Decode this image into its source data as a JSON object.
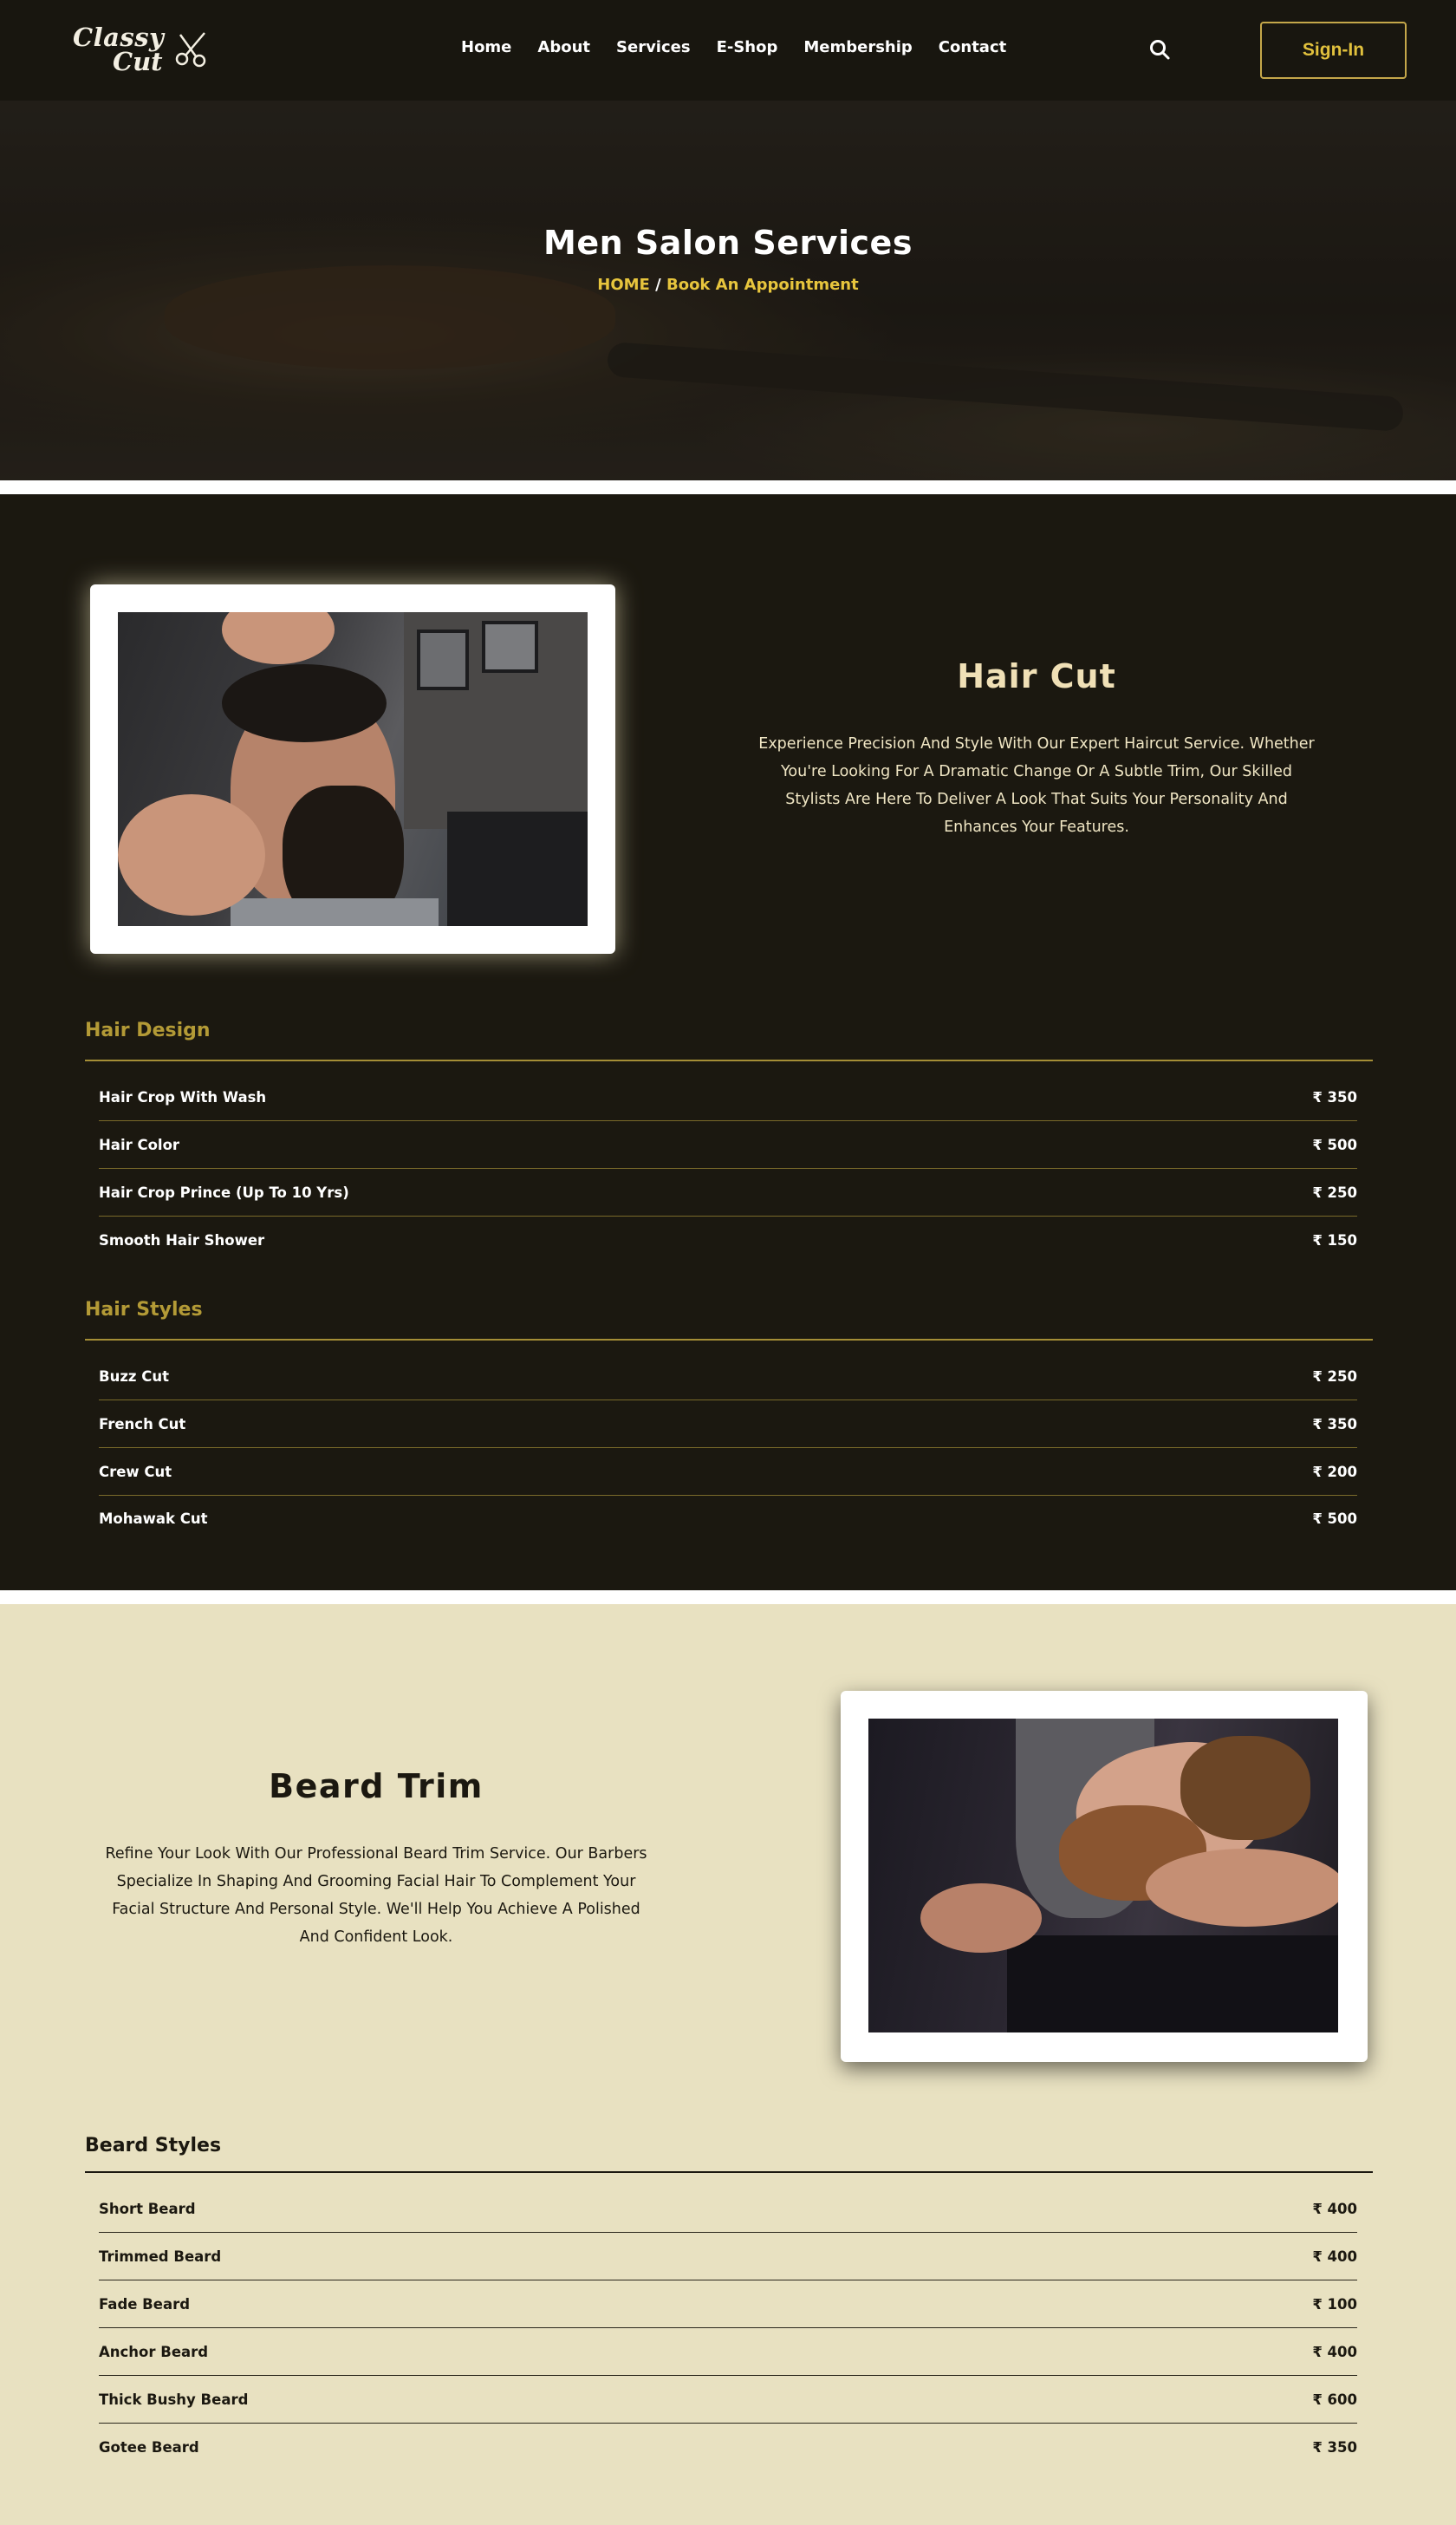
{
  "nav": {
    "logo_line1": "Classy",
    "logo_line2": "Cut",
    "items": [
      "Home",
      "About",
      "Services",
      "E-Shop",
      "Membership",
      "Contact"
    ],
    "search_icon": "search-icon",
    "signin_label": "Sign-In"
  },
  "hero": {
    "title": "Men Salon Services",
    "breadcrumb_home": "HOME",
    "breadcrumb_sep": "/",
    "breadcrumb_current": "Book An Appointment"
  },
  "hair": {
    "title": "Hair Cut",
    "description": "Experience Precision And Style With Our Expert Haircut Service. Whether You're Looking For A Dramatic Change Or A Subtle Trim, Our Skilled Stylists Are Here To Deliver A Look That Suits Your Personality And Enhances Your Features.",
    "categories": [
      {
        "name": "Hair Design",
        "items": [
          {
            "name": "Hair Crop With Wash",
            "price": "₹ 350"
          },
          {
            "name": "Hair Color",
            "price": "₹ 500"
          },
          {
            "name": "Hair Crop Prince (Up To 10 Yrs)",
            "price": "₹ 250"
          },
          {
            "name": "Smooth Hair Shower",
            "price": "₹ 150"
          }
        ]
      },
      {
        "name": "Hair Styles",
        "items": [
          {
            "name": "Buzz Cut",
            "price": "₹ 250"
          },
          {
            "name": "French Cut",
            "price": "₹ 350"
          },
          {
            "name": "Crew Cut",
            "price": "₹ 200"
          },
          {
            "name": "Mohawak Cut",
            "price": "₹ 500"
          }
        ]
      }
    ]
  },
  "beard": {
    "title": "Beard Trim",
    "description": "Refine Your Look With Our Professional Beard Trim Service. Our Barbers Specialize In Shaping And Grooming Facial Hair To Complement Your Facial Structure And Personal Style. We'll Help You Achieve A Polished And Confident Look.",
    "categories": [
      {
        "name": "Beard Styles",
        "items": [
          {
            "name": "Short Beard",
            "price": "₹ 400"
          },
          {
            "name": "Trimmed Beard",
            "price": "₹ 400"
          },
          {
            "name": "Fade Beard",
            "price": "₹ 100"
          },
          {
            "name": "Anchor Beard",
            "price": "₹ 400"
          },
          {
            "name": "Thick Bushy Beard",
            "price": "₹ 600"
          },
          {
            "name": "Gotee Beard",
            "price": "₹ 350"
          }
        ]
      }
    ]
  },
  "colors": {
    "dark_bg": "#1b1810",
    "light_bg": "#e8e1c1",
    "gold": "#e1c13d",
    "olive_heading": "#b39a36"
  }
}
